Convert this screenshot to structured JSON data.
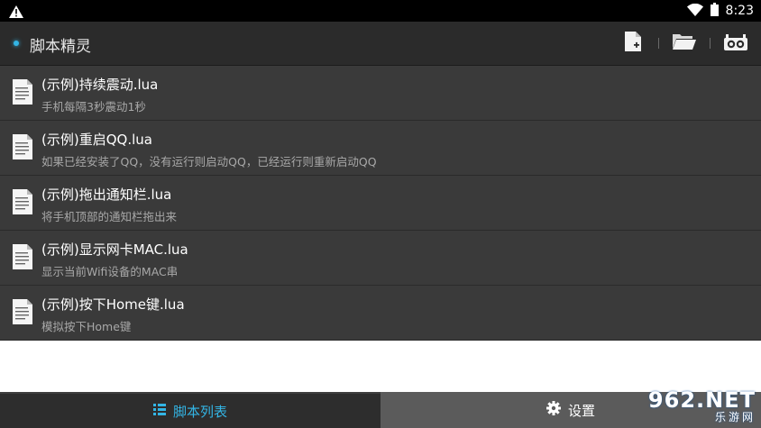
{
  "statusbar": {
    "time": "8:23",
    "icons": [
      "warning-icon",
      "wifi-icon",
      "battery-icon"
    ]
  },
  "app": {
    "title": "脚本精灵",
    "accent": "#33b5e5"
  },
  "toolbar": {
    "actions": [
      "new-file-icon",
      "folder-open-icon",
      "record-icon"
    ]
  },
  "scripts": [
    {
      "name": "(示例)持续震动.lua",
      "desc": "手机每隔3秒震动1秒"
    },
    {
      "name": "(示例)重启QQ.lua",
      "desc": "如果已经安装了QQ，没有运行则启动QQ，已经运行则重新启动QQ"
    },
    {
      "name": "(示例)拖出通知栏.lua",
      "desc": "将手机顶部的通知栏拖出来"
    },
    {
      "name": "(示例)显示网卡MAC.lua",
      "desc": "显示当前Wifi设备的MAC串"
    },
    {
      "name": "(示例)按下Home键.lua",
      "desc": "模拟按下Home键"
    }
  ],
  "tabs": {
    "scripts_label": "脚本列表",
    "settings_label": "设置"
  },
  "watermark": {
    "big": "962.NET",
    "small": "乐游网"
  }
}
